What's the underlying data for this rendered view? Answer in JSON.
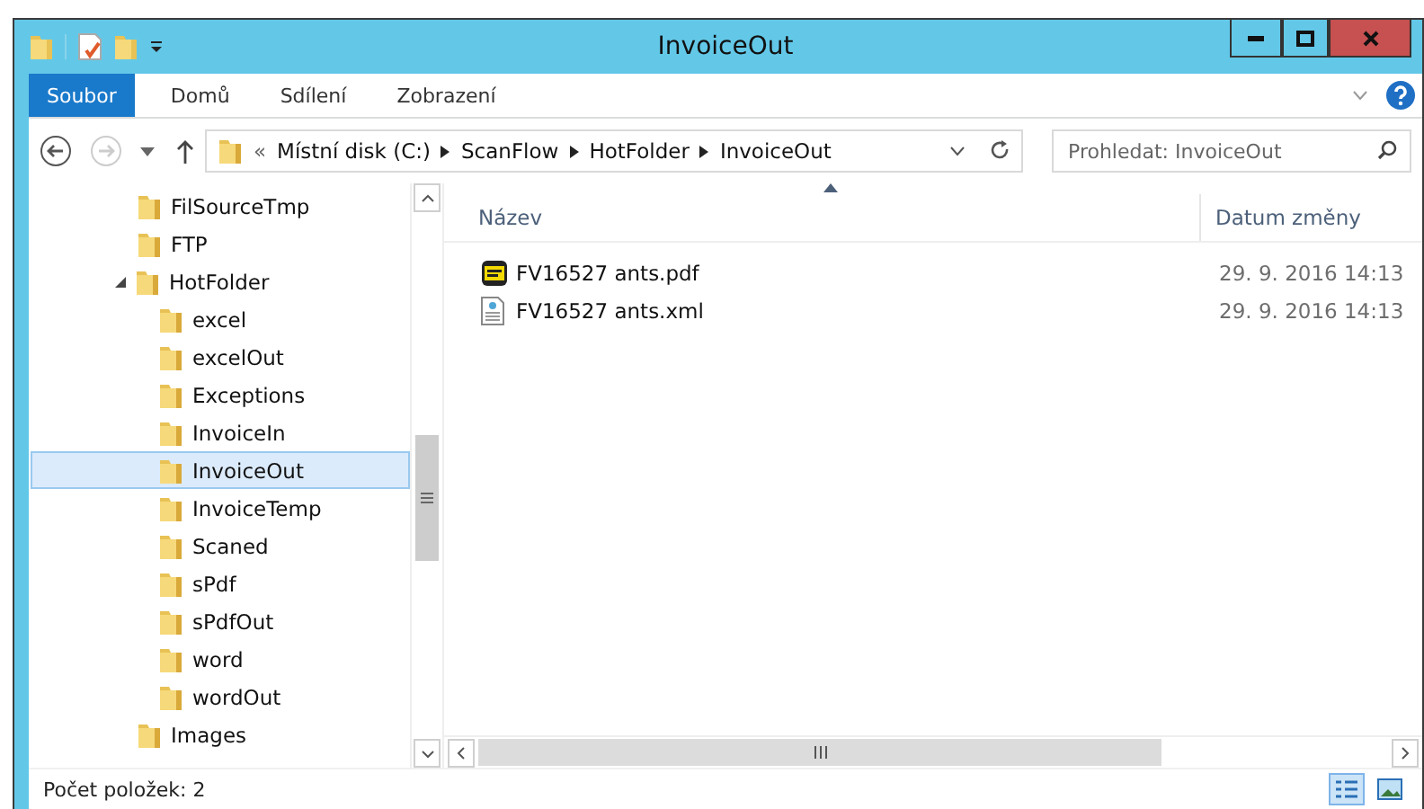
{
  "window": {
    "title": "InvoiceOut"
  },
  "ribbon_tabs": [
    {
      "label": "Soubor",
      "selected": true
    },
    {
      "label": "Domů",
      "selected": false
    },
    {
      "label": "Sdílení",
      "selected": false
    },
    {
      "label": "Zobrazení",
      "selected": false
    }
  ],
  "breadcrumb": {
    "overflow": "«",
    "segments": [
      "Místní disk (C:)",
      "ScanFlow",
      "HotFolder",
      "InvoiceOut"
    ]
  },
  "search": {
    "placeholder": "Prohledat: InvoiceOut"
  },
  "tree": [
    {
      "label": "FilSourceTmp",
      "selected": false
    },
    {
      "label": "FTP",
      "selected": false
    },
    {
      "label": "HotFolder",
      "selected": false,
      "expanded": true,
      "children": [
        {
          "label": "excel",
          "selected": false
        },
        {
          "label": "excelOut",
          "selected": false
        },
        {
          "label": "Exceptions",
          "selected": false
        },
        {
          "label": "InvoiceIn",
          "selected": false
        },
        {
          "label": "InvoiceOut",
          "selected": true
        },
        {
          "label": "InvoiceTemp",
          "selected": false
        },
        {
          "label": "Scaned",
          "selected": false
        },
        {
          "label": "sPdf",
          "selected": false
        },
        {
          "label": "sPdfOut",
          "selected": false
        },
        {
          "label": "word",
          "selected": false
        },
        {
          "label": "wordOut",
          "selected": false
        }
      ]
    },
    {
      "label": "Images",
      "selected": false
    }
  ],
  "table": {
    "columns": [
      "Název",
      "Datum změny"
    ],
    "rows": [
      {
        "kind": "pdf",
        "name": "FV16527 ants.pdf",
        "date": "29. 9. 2016 14:13"
      },
      {
        "kind": "xml",
        "name": "FV16527 ants.xml",
        "date": "29. 9. 2016 14:13"
      }
    ]
  },
  "status_bar": {
    "count": "Počet položek: 2"
  }
}
